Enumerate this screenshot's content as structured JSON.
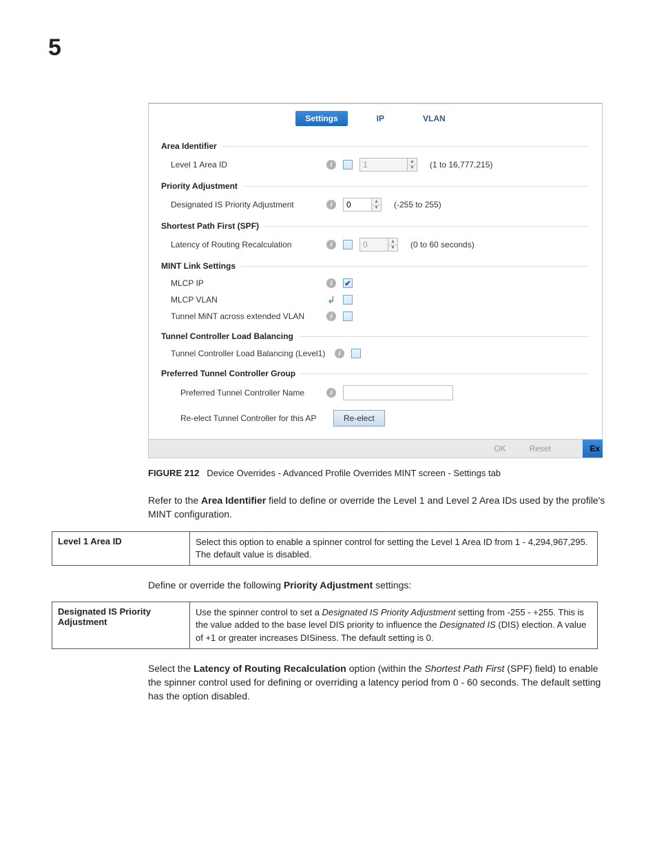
{
  "chapter_number": "5",
  "tabs": {
    "settings": "Settings",
    "ip": "IP",
    "vlan": "VLAN"
  },
  "groups": {
    "area_identifier": {
      "title": "Area Identifier",
      "level1_label": "Level 1 Area ID",
      "level1_value": "1",
      "level1_range": "(1 to 16,777,215)"
    },
    "priority_adjustment": {
      "title": "Priority Adjustment",
      "dis_label": "Designated IS Priority Adjustment",
      "dis_value": "0",
      "dis_range": "(-255 to 255)"
    },
    "spf": {
      "title": "Shortest Path First (SPF)",
      "latency_label": "Latency of Routing Recalculation",
      "latency_value": "0",
      "latency_range": "(0 to 60 seconds)"
    },
    "mint_link": {
      "title": "MINT Link Settings",
      "mlcp_ip": "MLCP IP",
      "mlcp_vlan": "MLCP VLAN",
      "tunnel_mint": "Tunnel MiNT across extended VLAN"
    },
    "tclb": {
      "title": "Tunnel Controller Load Balancing",
      "label": "Tunnel Controller Load Balancing (Level1)"
    },
    "ptcg": {
      "title": "Preferred Tunnel Controller Group",
      "name_label": "Preferred Tunnel Controller Name",
      "reelect_label": "Re-elect Tunnel Controller for this AP",
      "reelect_button": "Re-elect"
    }
  },
  "footer": {
    "ok": "OK",
    "reset": "Reset",
    "exit": "Ex"
  },
  "figure": {
    "number": "FIGURE 212",
    "caption": "Device Overrides - Advanced Profile Overrides MINT screen - Settings tab"
  },
  "para1": {
    "pre": "Refer to the ",
    "bold": "Area Identifier",
    "post": " field to define or override the Level 1 and Level 2 Area IDs used by the profile's MINT configuration."
  },
  "table1": {
    "key": "Level 1 Area ID",
    "val": "Select this option to enable a spinner control for setting the Level 1 Area ID from 1 - 4,294,967,295. The default value is disabled."
  },
  "para2": {
    "pre": "Define or override the following ",
    "bold": "Priority Adjustment",
    "post": " settings:"
  },
  "table2": {
    "key": "Designated IS Priority Adjustment",
    "pre": "Use the spinner control to set a ",
    "i1": "Designated IS Priority Adjustment",
    "mid1": " setting from -255 - +255. This is the value added to the base level DIS priority to influence the ",
    "i2": "Designated IS",
    "post": " (DIS) election. A value of +1 or greater increases DISiness. The default setting is 0."
  },
  "para3": {
    "p1": "Select the ",
    "b1": "Latency of Routing Recalculation",
    "p2": " option (within the ",
    "i1": "Shortest Path First",
    "p3": " (SPF) field) to enable the spinner control used for defining or overriding a latency period from 0 - 60 seconds. The default setting has the option disabled."
  }
}
